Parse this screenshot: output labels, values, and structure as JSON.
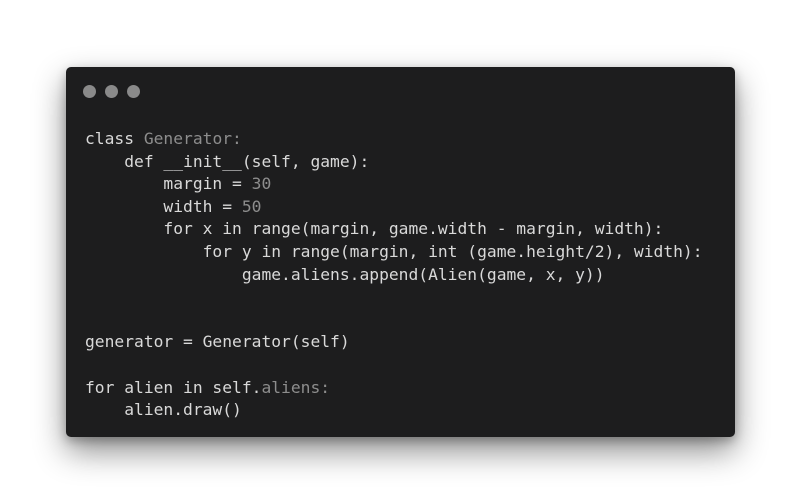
{
  "window": {
    "controls": [
      "close",
      "minimize",
      "maximize"
    ]
  },
  "colors": {
    "background": "#ffffff",
    "window_bg": "#1d1d1e",
    "text": "#d9d9d9",
    "muted": "#8d8d8d",
    "control_dot": "#8a8a8a"
  },
  "code": {
    "line_1": {
      "kw": "class ",
      "name": "Generator:"
    },
    "line_2": "    def __init__(self, game):",
    "line_3": {
      "text": "        margin = ",
      "num": "30"
    },
    "line_4": {
      "text": "        width = ",
      "num": "50"
    },
    "line_5": "        for x in range(margin, game.width - margin, width):",
    "line_6": "            for y in range(margin, int (game.height/2), width):",
    "line_7": "                game.aliens.append(Alien(game, x, y))",
    "line_8": "",
    "line_9": "",
    "line_10": "generator = Generator(self)",
    "line_11": "",
    "line_12": {
      "text": "for alien in self.",
      "attr": "aliens:"
    },
    "line_13": "    alien.draw()"
  }
}
